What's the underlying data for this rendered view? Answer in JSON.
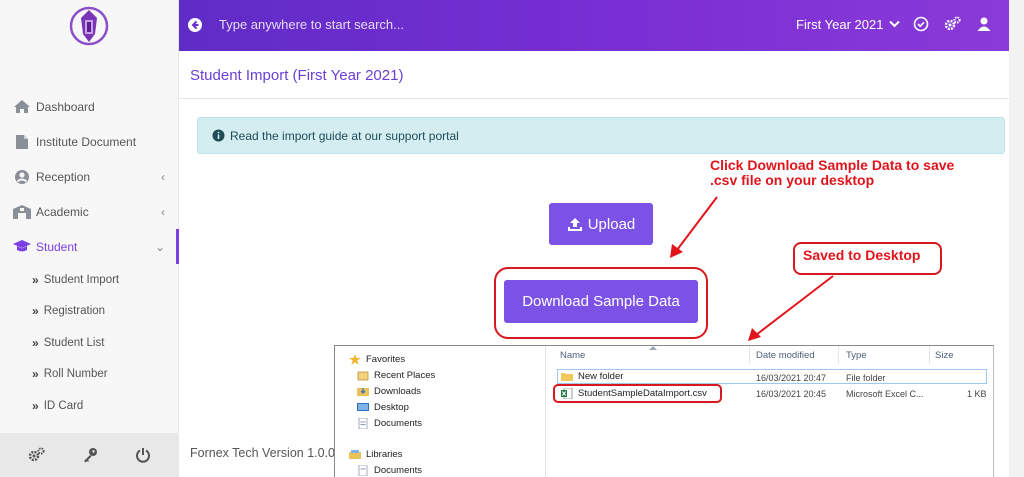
{
  "topbar": {
    "search_placeholder": "Type anywhere to start search...",
    "year_selector": "First Year 2021"
  },
  "sidebar": {
    "items": [
      {
        "label": "Dashboard",
        "icon": "home-icon"
      },
      {
        "label": "Institute Document",
        "icon": "document-icon"
      },
      {
        "label": "Reception",
        "icon": "user-circle-icon",
        "chevron": "‹"
      },
      {
        "label": "Academic",
        "icon": "building-icon",
        "chevron": "‹"
      },
      {
        "label": "Student",
        "icon": "graduation-cap-icon",
        "chevron": "⌄"
      }
    ],
    "subitems": [
      {
        "label": "Student Import"
      },
      {
        "label": "Registration"
      },
      {
        "label": "Student List"
      },
      {
        "label": "Roll Number"
      },
      {
        "label": "ID Card"
      }
    ],
    "footer_icons": [
      "gears-icon",
      "key-icon",
      "power-icon"
    ]
  },
  "page": {
    "title": "Student Import (First Year 2021)",
    "alert": "Read the import guide at our support portal",
    "upload_label": "Upload",
    "download_label": "Download Sample Data",
    "footer": "Fornex Tech Version 1.0.0"
  },
  "annotations": {
    "click_note_line1": "Click Download Sample Data to save",
    "click_note_line2": ".csv file on your desktop",
    "saved_note": "Saved to Desktop"
  },
  "explorer": {
    "nav": {
      "favorites": "Favorites",
      "recent": "Recent Places",
      "downloads": "Downloads",
      "desktop": "Desktop",
      "documents": "Documents",
      "libraries": "Libraries",
      "lib_documents": "Documents"
    },
    "columns": {
      "name": "Name",
      "date": "Date modified",
      "type": "Type",
      "size": "Size"
    },
    "files": [
      {
        "name": "New folder",
        "date": "16/03/2021 20:47",
        "type": "File folder",
        "size": ""
      },
      {
        "name": "StudentSampleDataImport.csv",
        "date": "16/03/2021 20:45",
        "type": "Microsoft Excel C...",
        "size": "1 KB"
      }
    ]
  },
  "colors": {
    "accent": "#7b51e6",
    "topbar": "#6a2fd0",
    "annotation": "#e2141b"
  }
}
